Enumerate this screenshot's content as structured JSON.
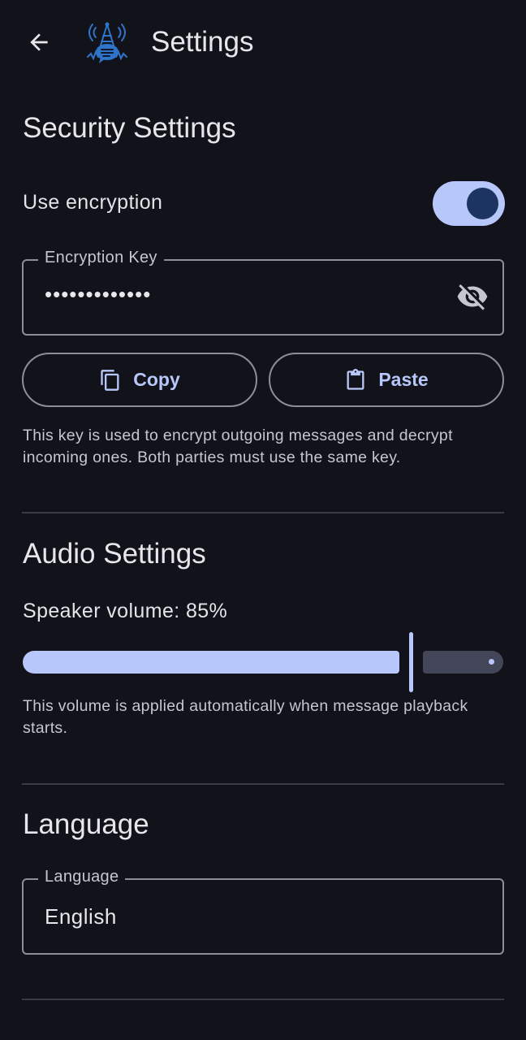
{
  "app_bar": {
    "title": "Settings",
    "back_icon": "arrow-back-icon",
    "logo_icon": "radio-tower-chat-logo"
  },
  "security": {
    "title": "Security Settings",
    "encryption_label": "Use encryption",
    "encryption_enabled": true,
    "key_field": {
      "label": "Encryption Key",
      "value": "•••••••••••••",
      "visibility_icon": "visibility-off-icon"
    },
    "copy_label": "Copy",
    "copy_icon": "copy-icon",
    "paste_label": "Paste",
    "paste_icon": "clipboard-icon",
    "helper": "This key is used to encrypt outgoing messages and decrypt incoming ones. Both parties must use the same key."
  },
  "audio": {
    "title": "Audio Settings",
    "volume_label": "Speaker volume: 85%",
    "volume_value": 0.85,
    "helper": "This volume is applied automatically when message playback starts."
  },
  "language": {
    "title": "Language",
    "field_label": "Language",
    "selected": "English"
  },
  "colors": {
    "background": "#12131a",
    "accent": "#b7c7f9",
    "toggle_thumb": "#1c3462",
    "outline": "#8c8e99"
  }
}
